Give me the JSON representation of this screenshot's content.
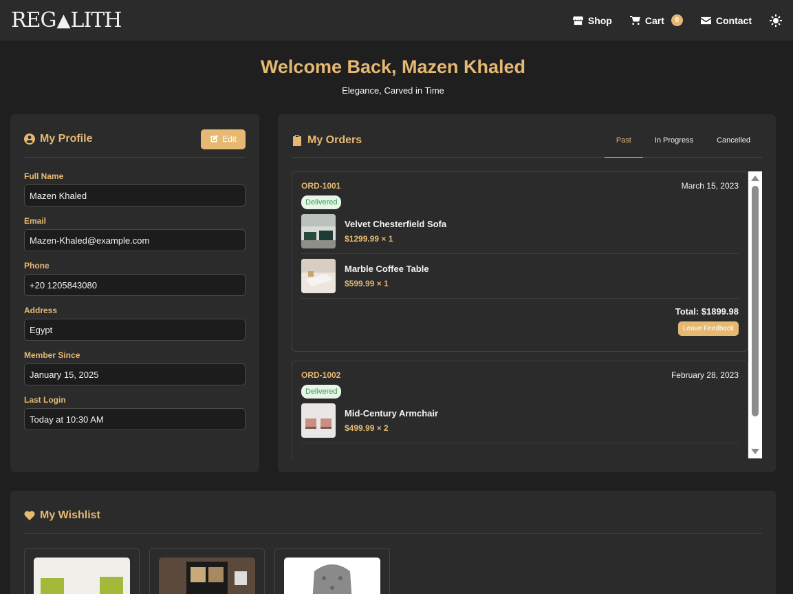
{
  "nav": {
    "logo": "REGALITH",
    "links": [
      {
        "label": "Shop",
        "icon": "store-icon"
      },
      {
        "label": "Cart",
        "icon": "cart-icon",
        "badge": "0"
      },
      {
        "label": "Contact",
        "icon": "envelope-icon"
      }
    ],
    "theme_icon": "sun-icon"
  },
  "hero": {
    "title": "Welcome Back, Mazen Khaled",
    "subtitle": "Elegance, Carved in Time"
  },
  "profile": {
    "title": "My Profile",
    "edit_label": "Edit",
    "fields": [
      {
        "label": "Full Name",
        "value": "Mazen Khaled"
      },
      {
        "label": "Email",
        "value": "Mazen-Khaled@example.com"
      },
      {
        "label": "Phone",
        "value": "+20 1205843080"
      },
      {
        "label": "Address",
        "value": "Egypt"
      },
      {
        "label": "Member Since",
        "value": "January 15, 2025"
      },
      {
        "label": "Last Login",
        "value": "Today at 10:30 AM"
      }
    ]
  },
  "orders": {
    "title": "My Orders",
    "tabs": [
      "Past",
      "In Progress",
      "Cancelled"
    ],
    "active_tab": "Past",
    "list": [
      {
        "id": "ORD-1001",
        "date": "March 15, 2023",
        "status": "Delivered",
        "items": [
          {
            "name": "Velvet Chesterfield Sofa",
            "price": "$1299.99 × 1"
          },
          {
            "name": "Marble Coffee Table",
            "price": "$599.99 × 1"
          }
        ],
        "total": "Total: $1899.98",
        "action": "Leave Feedback"
      },
      {
        "id": "ORD-1002",
        "date": "February 28, 2023",
        "status": "Delivered",
        "items": [
          {
            "name": "Mid-Century Armchair",
            "price": "$499.99 × 2"
          }
        ]
      }
    ]
  },
  "wishlist": {
    "title": "My Wishlist"
  },
  "colors": {
    "accent": "#e6b973",
    "background": "#1f1f1f",
    "card": "#2b2b2b",
    "status_green": "#2e9b47"
  }
}
